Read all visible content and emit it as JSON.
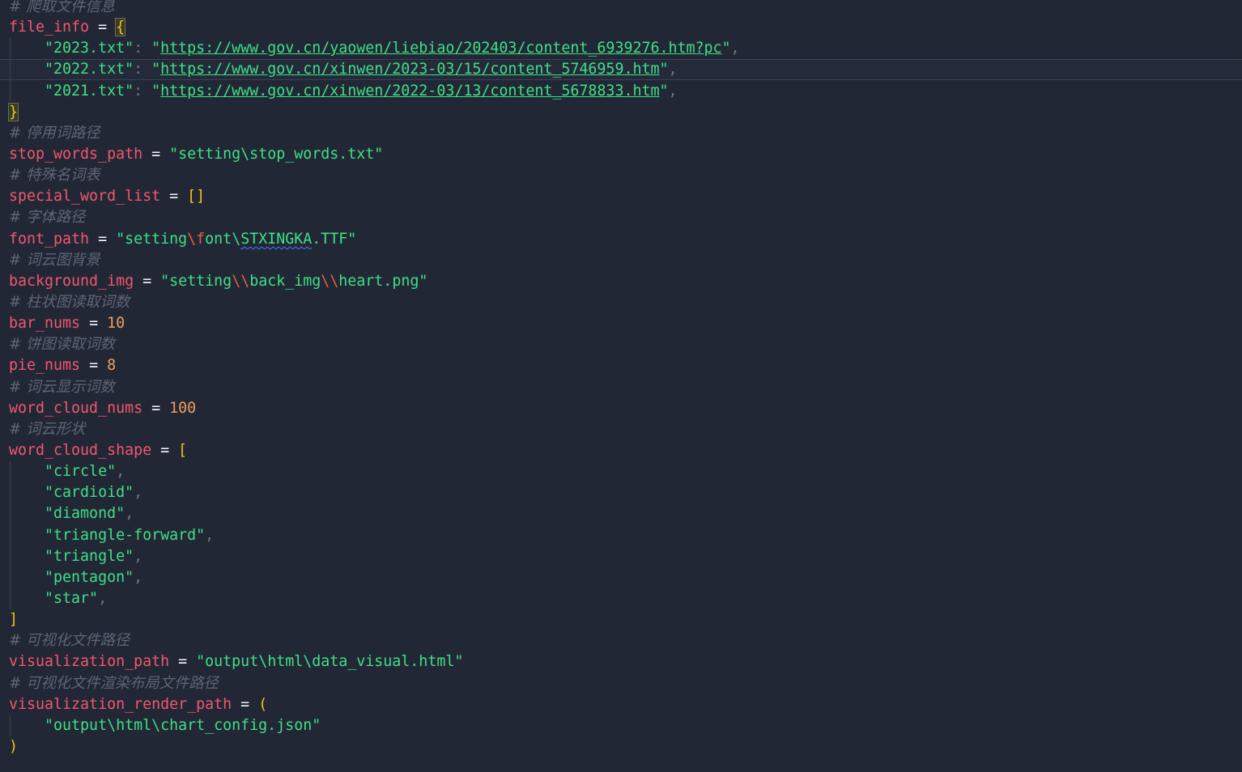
{
  "editor": {
    "theme_colors": {
      "background": "#222736",
      "comment": "#5d6475",
      "variable": "#f2576c",
      "string": "#3ee083",
      "number": "#f39c5a",
      "bracket": "#f1c40f",
      "escape": "#ee5c3c"
    },
    "lines": {
      "l0_comment": "# 爬取文件信息",
      "l1_var": "file_info",
      "l1_op": " = ",
      "l1_br": "{",
      "l2_key": "\"2023.txt\"",
      "l2_colon": ": ",
      "l2_q1": "\"",
      "l2_url": "https://www.gov.cn/yaowen/liebiao/202403/content_6939276.htm?pc",
      "l2_q2": "\"",
      "l2_comma": ",",
      "l3_key": "\"2022.txt\"",
      "l3_colon": ": ",
      "l3_q1": "\"",
      "l3_url": "https://www.gov.cn/xinwen/2023-03/15/content_5746959.htm",
      "l3_q2": "\"",
      "l3_comma": ",",
      "l4_key": "\"2021.txt\"",
      "l4_colon": ": ",
      "l4_q1": "\"",
      "l4_url": "https://www.gov.cn/xinwen/2022-03/13/content_5678833.htm",
      "l4_q2": "\"",
      "l4_comma": ",",
      "l5_br": "}",
      "l6_comment": "# 停用词路径",
      "l7_var": "stop_words_path",
      "l7_op": " = ",
      "l7_str": "\"setting\\stop_words.txt\"",
      "l8_comment": "# 特殊名词表",
      "l9_var": "special_word_list",
      "l9_op": " = ",
      "l9_br": "[]",
      "l10_comment": "# 字体路径",
      "l11_var": "font_path",
      "l11_op": " = ",
      "l11_s1": "\"setting",
      "l11_e1": "\\f",
      "l11_s2": "ont\\",
      "l11_sq": "STXINGKA",
      "l11_s3": ".TTF\"",
      "l12_comment": "# 词云图背景",
      "l13_var": "background_img",
      "l13_op": " = ",
      "l13_s1": "\"setting",
      "l13_e1": "\\\\",
      "l13_s2": "back_img",
      "l13_e2": "\\\\",
      "l13_s3": "heart.png\"",
      "l14_comment": "# 柱状图读取词数",
      "l15_var": "bar_nums",
      "l15_op": " = ",
      "l15_num": "10",
      "l16_comment": "# 饼图读取词数",
      "l17_var": "pie_nums",
      "l17_op": " = ",
      "l17_num": "8",
      "l18_comment": "# 词云显示词数",
      "l19_var": "word_cloud_nums",
      "l19_op": " = ",
      "l19_num": "100",
      "l20_comment": "# 词云形状",
      "l21_var": "word_cloud_shape",
      "l21_op": " = ",
      "l21_br": "[",
      "shapes": [
        "\"circle\"",
        "\"cardioid\"",
        "\"diamond\"",
        "\"triangle-forward\"",
        "\"triangle\"",
        "\"pentagon\"",
        "\"star\""
      ],
      "comma": ",",
      "l29_br": "]",
      "l30_comment": "# 可视化文件路径",
      "l31_var": "visualization_path",
      "l31_op": " = ",
      "l31_str": "\"output\\html\\data_visual.html\"",
      "l32_comment": "# 可视化文件渲染布局文件路径",
      "l33_var": "visualization_render_path",
      "l33_op": " = ",
      "l33_br": "(",
      "l34_str": "\"output\\html\\chart_config.json\"",
      "l35_br": ")"
    }
  }
}
